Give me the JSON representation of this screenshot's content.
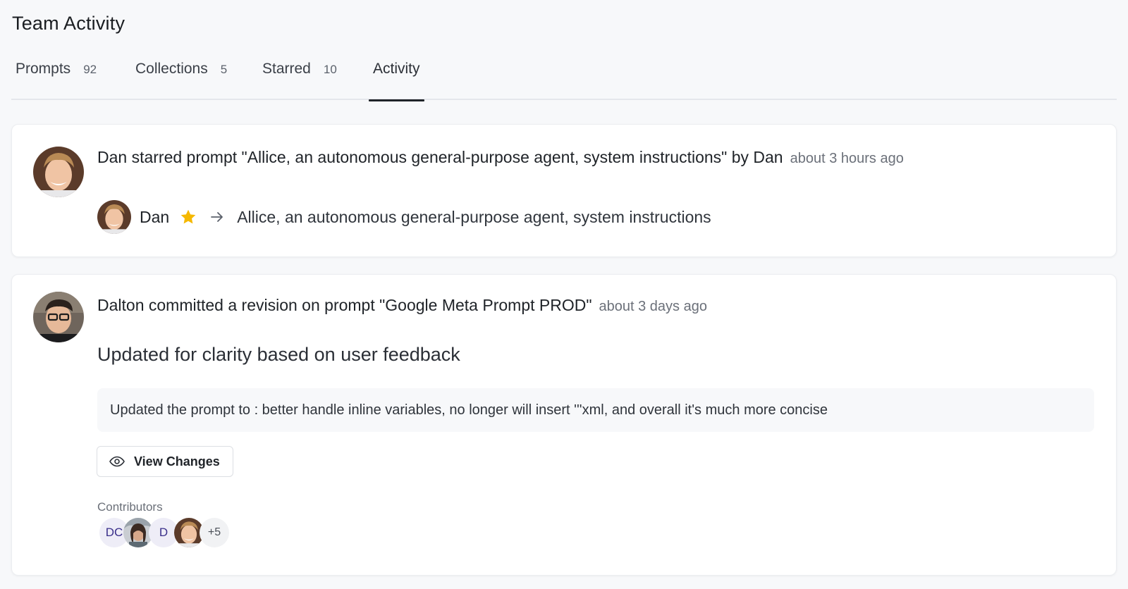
{
  "page": {
    "title": "Team Activity"
  },
  "tabs": [
    {
      "label": "Prompts",
      "count": "92"
    },
    {
      "label": "Collections",
      "count": "5"
    },
    {
      "label": "Starred",
      "count": "10"
    },
    {
      "label": "Activity",
      "count": ""
    }
  ],
  "active_tab": "Activity",
  "activity": [
    {
      "headline": "Dan starred prompt \"Allice, an autonomous general-purpose agent, system instructions\" by Dan",
      "time": "about 3 hours ago",
      "actor": "Dan",
      "target": "Allice, an autonomous general-purpose agent, system instructions",
      "icons": {
        "star": "star-icon",
        "arrow": "arrow-right-icon"
      }
    },
    {
      "headline": "Dalton committed a revision on prompt \"Google Meta Prompt PROD\"",
      "time": "about 3 days ago",
      "commit_title": "Updated for clarity based on user feedback",
      "commit_description": "Updated the prompt to : better handle inline variables, no longer will insert '''xml, and overall it's much more concise",
      "button_label": "View Changes",
      "contributors_label": "Contributors",
      "contributors": [
        "DC",
        "D",
        "+5"
      ]
    }
  ],
  "colors": {
    "accent_star": "#f5b800",
    "active_tab_underline": "#1f2328"
  }
}
